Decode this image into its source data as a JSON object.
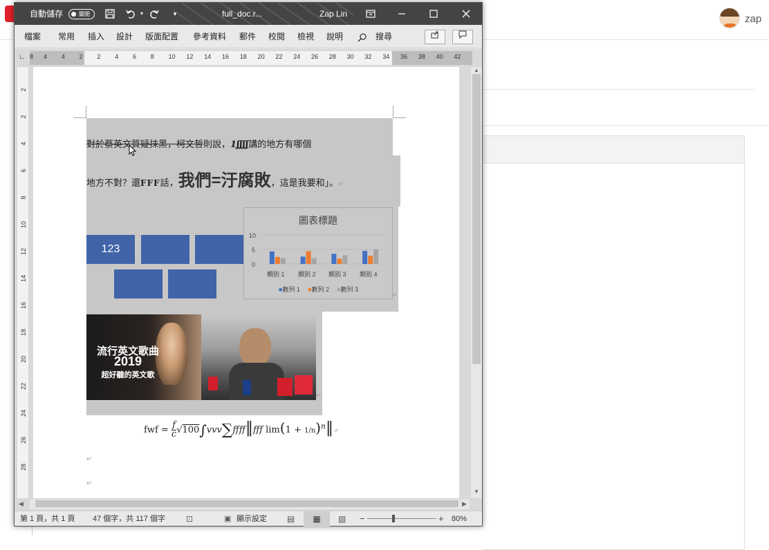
{
  "app": {
    "autosave_label": "自動儲存",
    "autosave_state": "關閉",
    "filename": "full_doc.r...",
    "user": "Zap Lin"
  },
  "menu": [
    "檔案",
    "常用",
    "插入",
    "設計",
    "版面配置",
    "參考資料",
    "郵件",
    "校閱",
    "檢視",
    "說明",
    "搜尋"
  ],
  "ruler": {
    "h_ticks": [
      "8",
      "4",
      "4",
      "2",
      "2",
      "4",
      "6",
      "8",
      "10",
      "12",
      "14",
      "16",
      "18",
      "20",
      "22",
      "24",
      "26",
      "28",
      "30",
      "32",
      "34",
      "36",
      "38",
      "40",
      "42"
    ],
    "v_ticks": [
      "2",
      "2",
      "4",
      "6",
      "8",
      "10",
      "12",
      "14",
      "16",
      "18",
      "20",
      "22",
      "24",
      "26",
      "28"
    ]
  },
  "document": {
    "line1": {
      "strike_part": "對於蔡英文質疑抹黑，柯文哲",
      "rest": "則說，",
      "italic_marks": "1ʆʆʆʆ",
      "tail": "講的地方有哪個"
    },
    "line2": {
      "a": "地方不對？還",
      "b": "FFF",
      "c": "話，",
      "big": "我們=汙腐敗",
      "d": "，這是我要和」。"
    },
    "shape_label": "123",
    "chart": {
      "title": "圖表標題",
      "y_ticks": [
        "10",
        "5",
        "0"
      ],
      "categories": [
        "類別 1",
        "類別 2",
        "類別 3",
        "類別 4"
      ],
      "legend": [
        "數列 1",
        "數列 2",
        "數列 3"
      ]
    },
    "image_text": {
      "line1": "流行英文歌曲",
      "line2": "2019",
      "line3": "超好聽的英文歌"
    },
    "formula_prefix": "fwf ="
  },
  "chart_data": {
    "type": "bar",
    "title": "圖表標題",
    "categories": [
      "類別 1",
      "類別 2",
      "類別 3",
      "類別 4"
    ],
    "series": [
      {
        "name": "數列 1",
        "values": [
          4.3,
          2.5,
          3.5,
          4.5
        ]
      },
      {
        "name": "數列 2",
        "values": [
          2.4,
          4.4,
          1.8,
          2.8
        ]
      },
      {
        "name": "數列 3",
        "values": [
          2,
          2,
          3,
          5
        ]
      }
    ],
    "ylim": [
      0,
      10
    ],
    "y_ticks": [
      0,
      5,
      10
    ],
    "colors": [
      "#4472c4",
      "#ed7d31",
      "#a5a5a5"
    ],
    "legend_position": "bottom",
    "grid": true
  },
  "status": {
    "page": "第 1 頁，共 1 頁",
    "words": "47 個字，共 117 個字",
    "display": "顯示設定",
    "zoom": "80%"
  },
  "background": {
    "username": "zap"
  }
}
